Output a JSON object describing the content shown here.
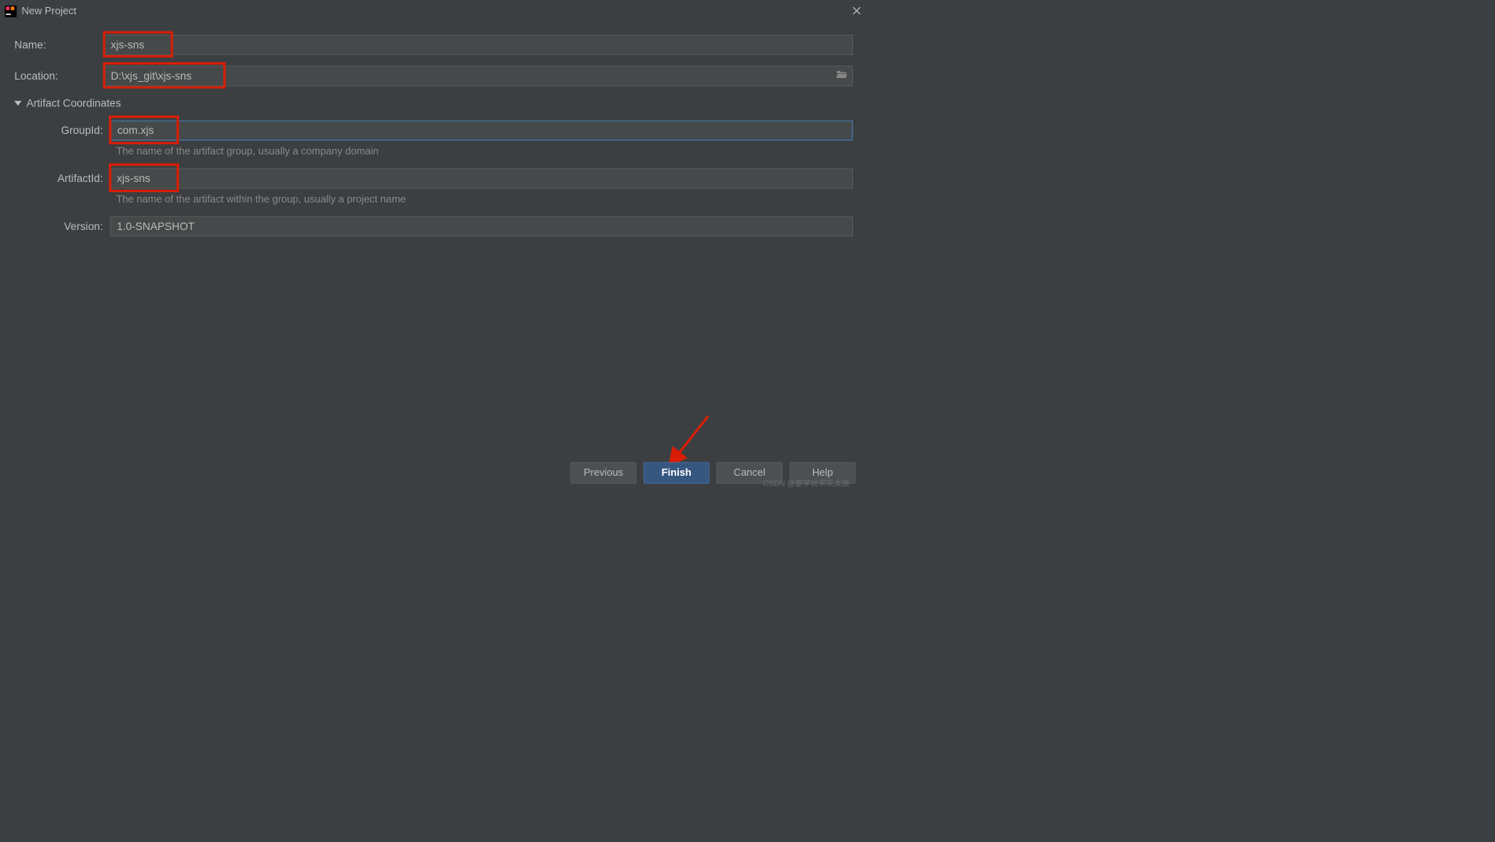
{
  "window": {
    "title": "New Project"
  },
  "form": {
    "name_label": "Name:",
    "name_value": "xjs-sns",
    "location_label": "Location:",
    "location_value": "D:\\xjs_git\\xjs-sns",
    "section_title": "Artifact Coordinates",
    "groupid_label": "GroupId:",
    "groupid_value": "com.xjs",
    "groupid_hint": "The name of the artifact group, usually a company domain",
    "artifactid_label": "ArtifactId:",
    "artifactid_value": "xjs-sns",
    "artifactid_hint": "The name of the artifact within the group, usually a project name",
    "version_label": "Version:",
    "version_value": "1.0-SNAPSHOT"
  },
  "buttons": {
    "previous": "Previous",
    "finish": "Finish",
    "cancel": "Cancel",
    "help": "Help"
  },
  "watermark": "CSDN @要学就学灰太狼"
}
